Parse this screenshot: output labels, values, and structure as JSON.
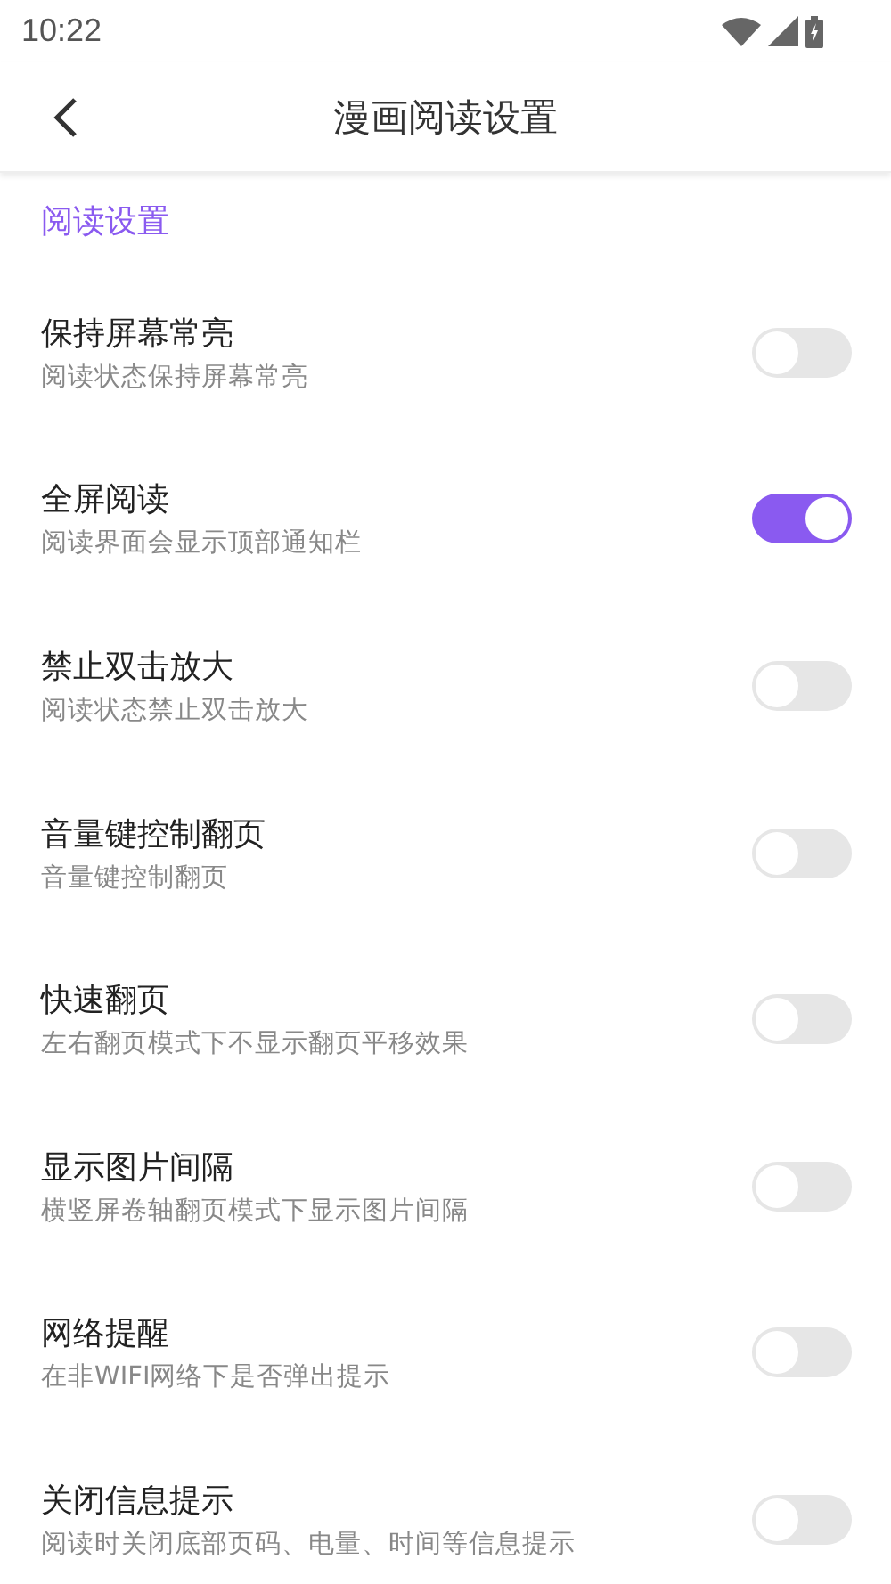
{
  "status_bar": {
    "time": "10:22"
  },
  "app_bar": {
    "title": "漫画阅读设置"
  },
  "section": {
    "title": "阅读设置"
  },
  "settings": [
    {
      "title": "保持屏幕常亮",
      "subtitle": "阅读状态保持屏幕常亮",
      "on": false
    },
    {
      "title": "全屏阅读",
      "subtitle": "阅读界面会显示顶部通知栏",
      "on": true
    },
    {
      "title": "禁止双击放大",
      "subtitle": "阅读状态禁止双击放大",
      "on": false
    },
    {
      "title": "音量键控制翻页",
      "subtitle": "音量键控制翻页",
      "on": false
    },
    {
      "title": "快速翻页",
      "subtitle": "左右翻页模式下不显示翻页平移效果",
      "on": false
    },
    {
      "title": "显示图片间隔",
      "subtitle": "横竖屏卷轴翻页模式下显示图片间隔",
      "on": false
    },
    {
      "title": "网络提醒",
      "subtitle": "在非WIFI网络下是否弹出提示",
      "on": false
    },
    {
      "title": "关闭信息提示",
      "subtitle": "阅读时关闭底部页码、电量、时间等信息提示",
      "on": false
    }
  ]
}
